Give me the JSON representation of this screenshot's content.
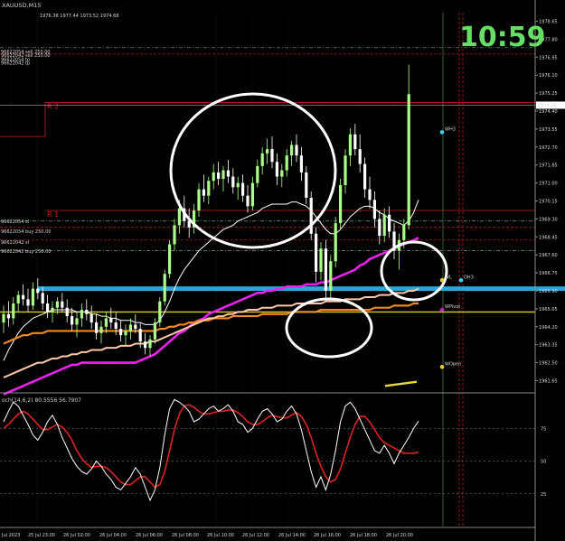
{
  "window": {
    "title": "XAUUSD,M15",
    "ohlc_info": "1976.38 1977.44 1973.52 1974.68"
  },
  "clock": "10:59",
  "colors": {
    "background": "#000000",
    "grid": "#3a4a3a",
    "bull": "#aaff88",
    "bear": "#ffffff",
    "ma_magenta": "#ee22ee",
    "ma_orange": "#f08820",
    "ma_peach": "#ffc8a8",
    "ma_white": "#ffffff",
    "h_line": "#22aadd",
    "stoch_main": "#ffffff",
    "stoch_signal": "#dd2222",
    "clock": "#66dd66",
    "level_red": "#cc2222",
    "level_green": "#66aa66",
    "annotation_circle": "#ffffff"
  },
  "price_scale": [
    "1978.65",
    "1977.80",
    "1976.95",
    "1976.10",
    "1975.25",
    "1974.40",
    "1973.55",
    "1972.70",
    "1971.85",
    "1971.00",
    "1970.15",
    "1969.30",
    "1968.45",
    "1967.60",
    "1966.75",
    "1965.90",
    "1965.05",
    "1964.20",
    "1963.35",
    "1962.50",
    "1961.65"
  ],
  "current_price": "1974.68",
  "stoch": {
    "label": "och(14,6,2) 80.5556 56.7907",
    "levels": [
      "75",
      "50",
      "25"
    ]
  },
  "time_labels": [
    "Jul 2023",
    "25 Jul 23:00",
    "26 Jul 02:00",
    "26 Jul 04:00",
    "26 Jul 06:00",
    "26 Jul 08:00",
    "26 Jul 10:00",
    "26 Jul 12:00",
    "26 Jul 14:00",
    "26 Jul 16:00",
    "26 Jul 18:00",
    "26 Jul 20:00"
  ],
  "order_labels": {
    "top": [
      "96622054 sell 250.00",
      "96622042 sell 250.00",
      "96622054 tp",
      "96622042 tp"
    ],
    "mid": [
      "96622054 sl",
      "96622054 buy 250.00",
      "96622042 sl",
      "96622042 buy 250.00"
    ]
  },
  "level_labels": {
    "R2": "R 2",
    "R1": "R 1",
    "WH3": "WH3",
    "WL": "WL",
    "OH3": "OH3",
    "WPivot": "WPivot",
    "WOpen": "WOpen"
  },
  "chart_data": {
    "type": "candlestick",
    "symbol": "XAUUSD",
    "timeframe": "M15",
    "ylim": [
      1961.2,
      1979.1
    ],
    "candles": [
      [
        1964.4,
        1965.2,
        1963.9,
        1964.8
      ],
      [
        1964.8,
        1965.4,
        1964.2,
        1964.6
      ],
      [
        1964.6,
        1965.6,
        1964.3,
        1965.3
      ],
      [
        1965.3,
        1965.9,
        1964.9,
        1965.7
      ],
      [
        1965.7,
        1966.2,
        1965.2,
        1965.5
      ],
      [
        1965.5,
        1966.0,
        1964.9,
        1965.2
      ],
      [
        1965.2,
        1966.3,
        1965.0,
        1966.0
      ],
      [
        1966.0,
        1966.5,
        1965.5,
        1965.8
      ],
      [
        1965.8,
        1966.1,
        1965.0,
        1965.3
      ],
      [
        1965.3,
        1965.7,
        1964.6,
        1964.9
      ],
      [
        1964.9,
        1965.4,
        1964.4,
        1965.1
      ],
      [
        1965.1,
        1965.6,
        1964.8,
        1965.4
      ],
      [
        1965.4,
        1965.8,
        1964.9,
        1965.1
      ],
      [
        1965.1,
        1965.5,
        1964.4,
        1964.7
      ],
      [
        1964.7,
        1965.1,
        1964.0,
        1964.3
      ],
      [
        1964.3,
        1964.9,
        1963.7,
        1964.6
      ],
      [
        1964.6,
        1965.3,
        1964.2,
        1965.0
      ],
      [
        1965.0,
        1965.5,
        1964.5,
        1964.8
      ],
      [
        1964.8,
        1965.2,
        1964.1,
        1964.4
      ],
      [
        1964.4,
        1964.8,
        1963.6,
        1963.9
      ],
      [
        1963.9,
        1964.5,
        1963.4,
        1964.2
      ],
      [
        1964.2,
        1964.9,
        1963.9,
        1964.6
      ],
      [
        1964.6,
        1965.1,
        1964.1,
        1964.4
      ],
      [
        1964.4,
        1964.9,
        1963.8,
        1964.1
      ],
      [
        1964.1,
        1964.5,
        1963.5,
        1963.8
      ],
      [
        1963.8,
        1964.3,
        1963.3,
        1964.0
      ],
      [
        1964.0,
        1964.6,
        1963.6,
        1964.3
      ],
      [
        1964.3,
        1964.8,
        1963.9,
        1964.1
      ],
      [
        1964.1,
        1964.4,
        1963.2,
        1963.5
      ],
      [
        1963.5,
        1963.9,
        1962.9,
        1963.2
      ],
      [
        1963.2,
        1963.8,
        1962.8,
        1963.6
      ],
      [
        1963.6,
        1964.6,
        1963.4,
        1964.4
      ],
      [
        1964.4,
        1965.6,
        1964.2,
        1965.4
      ],
      [
        1965.4,
        1966.9,
        1965.2,
        1966.7
      ],
      [
        1966.7,
        1968.3,
        1966.5,
        1968.1
      ],
      [
        1968.1,
        1969.3,
        1967.8,
        1969.0
      ],
      [
        1969.0,
        1970.2,
        1968.6,
        1969.8
      ],
      [
        1969.8,
        1970.4,
        1968.9,
        1969.2
      ],
      [
        1969.2,
        1969.8,
        1968.4,
        1968.9
      ],
      [
        1968.9,
        1970.0,
        1968.6,
        1969.7
      ],
      [
        1969.7,
        1971.0,
        1969.4,
        1970.7
      ],
      [
        1970.7,
        1971.4,
        1970.1,
        1970.4
      ],
      [
        1970.4,
        1971.3,
        1970.0,
        1971.1
      ],
      [
        1971.1,
        1971.9,
        1970.7,
        1971.5
      ],
      [
        1971.5,
        1972.0,
        1970.9,
        1971.2
      ],
      [
        1971.2,
        1971.8,
        1970.6,
        1971.6
      ],
      [
        1971.6,
        1972.1,
        1971.0,
        1971.3
      ],
      [
        1971.3,
        1971.7,
        1970.5,
        1970.8
      ],
      [
        1970.8,
        1971.3,
        1970.2,
        1971.0
      ],
      [
        1971.0,
        1971.4,
        1970.1,
        1970.4
      ],
      [
        1970.4,
        1970.9,
        1969.6,
        1969.9
      ],
      [
        1969.9,
        1971.3,
        1969.7,
        1971.0
      ],
      [
        1971.0,
        1972.1,
        1970.8,
        1971.8
      ],
      [
        1971.8,
        1972.7,
        1971.4,
        1972.4
      ],
      [
        1972.4,
        1973.1,
        1971.9,
        1972.6
      ],
      [
        1972.6,
        1973.2,
        1971.7,
        1972.0
      ],
      [
        1972.0,
        1972.4,
        1970.9,
        1971.3
      ],
      [
        1971.3,
        1971.9,
        1970.8,
        1971.6
      ],
      [
        1971.6,
        1972.6,
        1971.3,
        1972.3
      ],
      [
        1972.3,
        1973.0,
        1971.8,
        1972.8
      ],
      [
        1972.8,
        1973.3,
        1972.0,
        1972.3
      ],
      [
        1972.3,
        1972.7,
        1971.1,
        1971.5
      ],
      [
        1971.5,
        1971.8,
        1970.0,
        1970.3
      ],
      [
        1970.3,
        1970.6,
        1968.3,
        1968.6
      ],
      [
        1968.6,
        1968.9,
        1966.3,
        1966.8
      ],
      [
        1966.8,
        1968.2,
        1966.4,
        1967.9
      ],
      [
        1967.9,
        1968.3,
        1965.4,
        1965.9
      ],
      [
        1965.9,
        1967.6,
        1965.5,
        1967.3
      ],
      [
        1967.3,
        1969.4,
        1967.0,
        1969.1
      ],
      [
        1969.1,
        1971.2,
        1968.8,
        1970.9
      ],
      [
        1970.9,
        1972.6,
        1970.5,
        1972.3
      ],
      [
        1972.3,
        1973.6,
        1971.8,
        1973.3
      ],
      [
        1973.3,
        1973.8,
        1972.3,
        1972.6
      ],
      [
        1972.6,
        1973.3,
        1971.5,
        1971.9
      ],
      [
        1971.9,
        1972.2,
        1970.3,
        1970.7
      ],
      [
        1970.7,
        1971.3,
        1969.8,
        1970.2
      ],
      [
        1970.2,
        1970.6,
        1968.9,
        1969.3
      ],
      [
        1969.3,
        1969.7,
        1968.1,
        1968.5
      ],
      [
        1968.5,
        1969.8,
        1968.2,
        1969.5
      ],
      [
        1969.5,
        1969.9,
        1968.4,
        1968.7
      ],
      [
        1968.7,
        1969.1,
        1967.4,
        1967.8
      ],
      [
        1967.8,
        1968.6,
        1966.9,
        1968.3
      ],
      [
        1968.3,
        1969.3,
        1967.9,
        1969.0
      ],
      [
        1969.0,
        1976.6,
        1968.8,
        1975.2
      ]
    ],
    "moving_averages": [
      {
        "name": "MA white",
        "values": [
          1962.6,
          1963.1,
          1963.5,
          1963.9,
          1964.2,
          1964.4,
          1964.6,
          1964.7,
          1964.8,
          1964.9,
          1965.0,
          1965.0,
          1965.0,
          1965.0,
          1965.0,
          1964.9,
          1964.9,
          1964.9,
          1964.8,
          1964.8,
          1964.7,
          1964.7,
          1964.6,
          1964.6,
          1964.5,
          1964.5,
          1964.5,
          1964.4,
          1964.4,
          1964.3,
          1964.3,
          1964.3,
          1964.5,
          1964.9,
          1965.4,
          1966.0,
          1966.5,
          1966.9,
          1967.2,
          1967.5,
          1967.8,
          1968.0,
          1968.2,
          1968.4,
          1968.6,
          1968.8,
          1968.9,
          1969.0,
          1969.2,
          1969.3,
          1969.4,
          1969.5,
          1969.6,
          1969.8,
          1969.9,
          1970.0,
          1970.0,
          1970.0,
          1970.0,
          1970.1,
          1970.1,
          1970.0,
          1969.9,
          1969.7,
          1969.4,
          1969.1,
          1968.8,
          1968.6,
          1968.6,
          1968.8,
          1969.1,
          1969.4,
          1969.6,
          1969.8,
          1969.9,
          1969.9,
          1969.8,
          1969.6,
          1969.5,
          1969.3,
          1969.2,
          1969.1,
          1969.0,
          1969.2,
          1969.6,
          1970.2
        ]
      },
      {
        "name": "MA magenta",
        "values": [
          1961.0,
          1961.1,
          1961.2,
          1961.3,
          1961.4,
          1961.5,
          1961.6,
          1961.7,
          1961.8,
          1961.9,
          1962.0,
          1962.1,
          1962.2,
          1962.3,
          1962.4,
          1962.4,
          1962.5,
          1962.5,
          1962.5,
          1962.5,
          1962.5,
          1962.5,
          1962.5,
          1962.5,
          1962.5,
          1962.5,
          1962.5,
          1962.5,
          1962.6,
          1962.7,
          1962.8,
          1962.9,
          1963.1,
          1963.3,
          1963.5,
          1963.7,
          1963.9,
          1964.0,
          1964.2,
          1964.4,
          1964.5,
          1964.6,
          1964.8,
          1964.9,
          1965.0,
          1965.1,
          1965.2,
          1965.3,
          1965.4,
          1965.5,
          1965.6,
          1965.7,
          1965.8,
          1965.8,
          1965.9,
          1965.9,
          1966.0,
          1966.0,
          1966.1,
          1966.1,
          1966.1,
          1966.1,
          1966.2,
          1966.2,
          1966.2,
          1966.3,
          1966.3,
          1966.4,
          1966.5,
          1966.6,
          1966.7,
          1966.8,
          1966.9,
          1967.1,
          1967.2,
          1967.4,
          1967.5,
          1967.6,
          1967.7,
          1967.8,
          1967.9,
          1968.0,
          1968.1,
          1968.2,
          1968.3,
          1968.4
        ]
      },
      {
        "name": "MA orange",
        "values": [
          1963.4,
          1963.5,
          1963.6,
          1963.7,
          1963.8,
          1963.8,
          1963.9,
          1963.9,
          1963.9,
          1964.0,
          1964.0,
          1964.0,
          1964.0,
          1964.0,
          1964.0,
          1964.0,
          1964.0,
          1964.0,
          1964.0,
          1964.0,
          1964.0,
          1964.0,
          1964.0,
          1964.0,
          1964.0,
          1964.0,
          1964.0,
          1964.0,
          1964.0,
          1964.0,
          1964.0,
          1964.0,
          1964.1,
          1964.1,
          1964.2,
          1964.2,
          1964.3,
          1964.3,
          1964.4,
          1964.4,
          1964.5,
          1964.5,
          1964.5,
          1964.6,
          1964.6,
          1964.6,
          1964.6,
          1964.7,
          1964.7,
          1964.7,
          1964.7,
          1964.7,
          1964.7,
          1964.8,
          1964.8,
          1964.8,
          1964.8,
          1964.8,
          1964.8,
          1964.9,
          1964.9,
          1964.9,
          1964.9,
          1964.9,
          1964.9,
          1965.0,
          1965.0,
          1965.0,
          1965.0,
          1965.0,
          1965.0,
          1965.0,
          1965.0,
          1965.0,
          1965.0,
          1965.0,
          1965.1,
          1965.1,
          1965.1,
          1965.1,
          1965.2,
          1965.2,
          1965.2,
          1965.2,
          1965.3,
          1965.3
        ]
      },
      {
        "name": "MA peach",
        "values": [
          1961.8,
          1961.9,
          1962.0,
          1962.1,
          1962.2,
          1962.3,
          1962.4,
          1962.5,
          1962.5,
          1962.6,
          1962.7,
          1962.7,
          1962.8,
          1962.8,
          1962.9,
          1962.9,
          1963.0,
          1963.0,
          1963.1,
          1963.1,
          1963.1,
          1963.2,
          1963.2,
          1963.2,
          1963.3,
          1963.3,
          1963.3,
          1963.4,
          1963.4,
          1963.4,
          1963.5,
          1963.5,
          1963.6,
          1963.7,
          1963.8,
          1963.9,
          1964.0,
          1964.1,
          1964.2,
          1964.3,
          1964.4,
          1964.5,
          1964.6,
          1964.6,
          1964.7,
          1964.7,
          1964.8,
          1964.8,
          1964.9,
          1964.9,
          1965.0,
          1965.0,
          1965.0,
          1965.1,
          1965.1,
          1965.1,
          1965.2,
          1965.2,
          1965.2,
          1965.2,
          1965.3,
          1965.3,
          1965.3,
          1965.3,
          1965.3,
          1965.3,
          1965.4,
          1965.4,
          1965.4,
          1965.4,
          1965.5,
          1965.5,
          1965.5,
          1965.5,
          1965.6,
          1965.6,
          1965.6,
          1965.7,
          1965.7,
          1965.7,
          1965.8,
          1965.8,
          1965.8,
          1965.9,
          1965.9,
          1966.0
        ]
      }
    ],
    "horizontal_levels": [
      {
        "name": "blue support",
        "price": 1966.0
      },
      {
        "name": "R2",
        "price": 1974.8
      },
      {
        "name": "R1",
        "price": 1969.7
      },
      {
        "name": "yellow line",
        "price": 1964.9
      },
      {
        "name": "dashed red",
        "price": 1968.9
      },
      {
        "name": "dashed red",
        "price": 1968.3
      },
      {
        "name": "dashed red",
        "price": 1977.1
      },
      {
        "name": "dashed green",
        "price": 1969.2
      },
      {
        "name": "dashed green",
        "price": 1967.8
      },
      {
        "name": "dashed green",
        "price": 1977.4
      }
    ],
    "markers": [
      {
        "name": "WH3",
        "price": 1973.4
      },
      {
        "name": "WL",
        "price": 1966.4
      },
      {
        "name": "OH3",
        "price": 1966.4
      },
      {
        "name": "WPivot",
        "price": 1965.0
      },
      {
        "name": "WOpen",
        "price": 1962.3
      }
    ],
    "stochastic": {
      "name": "Stoch(14,6,2)",
      "ylim": [
        0,
        100
      ],
      "levels": [
        75,
        50,
        25
      ],
      "main": [
        80,
        88,
        95,
        92,
        85,
        78,
        70,
        66,
        72,
        80,
        85,
        78,
        68,
        60,
        52,
        46,
        42,
        40,
        44,
        50,
        46,
        40,
        36,
        30,
        28,
        33,
        38,
        45,
        40,
        30,
        20,
        28,
        45,
        70,
        90,
        97,
        95,
        92,
        88,
        80,
        82,
        86,
        90,
        92,
        88,
        90,
        93,
        88,
        80,
        78,
        72,
        75,
        82,
        88,
        90,
        86,
        80,
        82,
        88,
        92,
        86,
        74,
        58,
        42,
        30,
        38,
        28,
        40,
        58,
        80,
        92,
        95,
        90,
        82,
        74,
        66,
        58,
        56,
        62,
        56,
        48,
        56,
        62,
        68,
        75,
        80.6
      ],
      "signal": [
        75,
        78,
        82,
        86,
        88,
        86,
        82,
        78,
        74,
        74,
        76,
        78,
        76,
        72,
        66,
        58,
        52,
        48,
        45,
        46,
        46,
        45,
        42,
        38,
        34,
        32,
        32,
        35,
        38,
        38,
        34,
        30,
        32,
        42,
        58,
        74,
        86,
        92,
        93,
        91,
        88,
        86,
        86,
        87,
        88,
        88,
        89,
        89,
        87,
        84,
        80,
        78,
        78,
        80,
        83,
        85,
        84,
        83,
        83,
        85,
        87,
        84,
        78,
        68,
        56,
        46,
        38,
        34,
        36,
        44,
        56,
        68,
        78,
        84,
        84,
        80,
        74,
        68,
        64,
        62,
        60,
        58,
        56,
        56,
        56,
        56.8
      ]
    }
  }
}
